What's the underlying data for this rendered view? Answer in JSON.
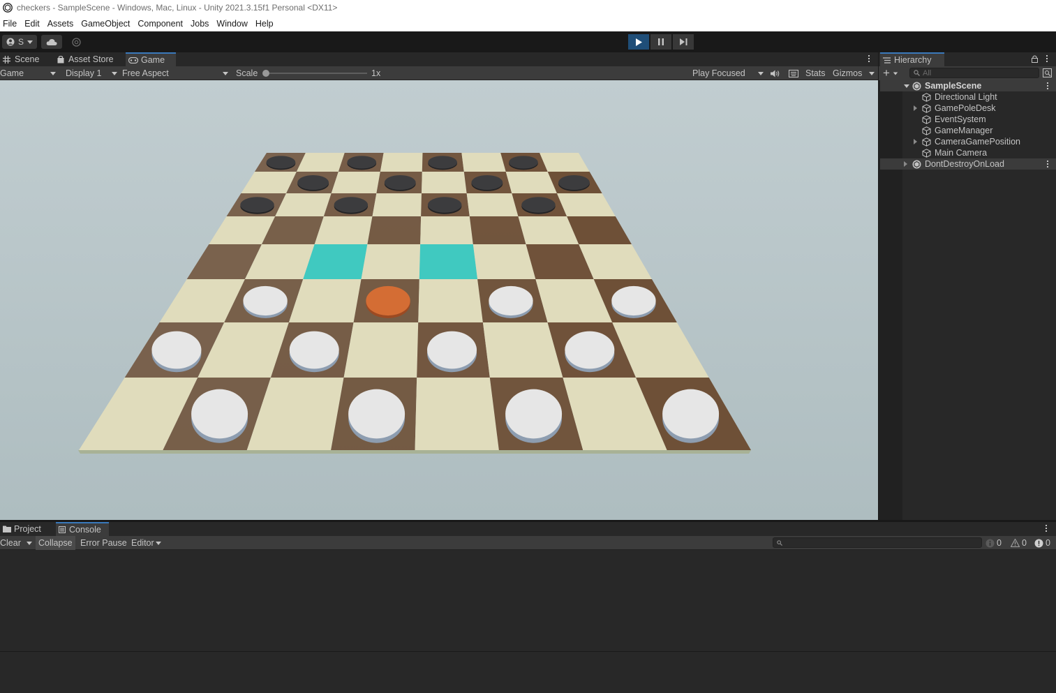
{
  "window": {
    "title": "checkers - SampleScene - Windows, Mac, Linux - Unity 2021.3.15f1 Personal <DX11>"
  },
  "menu": [
    "File",
    "Edit",
    "Assets",
    "GameObject",
    "Component",
    "Jobs",
    "Window",
    "Help"
  ],
  "toolbar": {
    "account_label": "S",
    "icons": [
      "account-icon",
      "cloud-icon",
      "collab-icon",
      "play-icon",
      "pause-icon",
      "step-icon"
    ]
  },
  "game_view": {
    "tabs": [
      "Scene",
      "Asset Store",
      "Game"
    ],
    "active_tab": "Game",
    "controls": {
      "mode": "Game",
      "display": "Display 1",
      "aspect": "Free Aspect",
      "scale_label": "Scale",
      "scale_value": "1x",
      "play_focused": "Play Focused",
      "stats": "Stats",
      "gizmos": "Gizmos"
    },
    "colors": {
      "sky": "#b2c1c4",
      "light_square": "#e0dcbc",
      "dark_square": "#6e5037",
      "highlight": "#40c9c0",
      "black_piece": "#3c3c3e",
      "white_piece": "#e6e6e6",
      "selected_piece": "#d46d34"
    },
    "board": {
      "rows": 8,
      "cols": 8,
      "highlighted_squares": [
        [
          4,
          2
        ],
        [
          4,
          4
        ]
      ],
      "black_pieces": [
        [
          0,
          0
        ],
        [
          0,
          2
        ],
        [
          0,
          4
        ],
        [
          0,
          6
        ],
        [
          1,
          1
        ],
        [
          1,
          3
        ],
        [
          1,
          5
        ],
        [
          1,
          7
        ],
        [
          2,
          0
        ],
        [
          2,
          2
        ],
        [
          2,
          4
        ],
        [
          2,
          6
        ]
      ],
      "white_pieces": [
        [
          5,
          1
        ],
        [
          5,
          5
        ],
        [
          5,
          7
        ],
        [
          6,
          0
        ],
        [
          6,
          2
        ],
        [
          6,
          4
        ],
        [
          6,
          6
        ],
        [
          7,
          1
        ],
        [
          7,
          3
        ],
        [
          7,
          5
        ],
        [
          7,
          7
        ]
      ],
      "selected_pieces": [
        [
          5,
          3
        ]
      ]
    }
  },
  "hierarchy": {
    "title": "Hierarchy",
    "search_placeholder": "All",
    "items": [
      {
        "label": "SampleScene",
        "type": "scene",
        "expanded": true
      },
      {
        "label": "Directional Light",
        "type": "object"
      },
      {
        "label": "GamePoleDesk",
        "type": "object",
        "has_children": true
      },
      {
        "label": "EventSystem",
        "type": "object"
      },
      {
        "label": "GameManager",
        "type": "object"
      },
      {
        "label": "CameraGamePosition",
        "type": "object",
        "has_children": true
      },
      {
        "label": "Main Camera",
        "type": "object"
      },
      {
        "label": "DontDestroyOnLoad",
        "type": "scene",
        "expanded": false
      }
    ]
  },
  "bottom_panel": {
    "tabs": [
      "Project",
      "Console"
    ],
    "active_tab": "Console",
    "buttons": {
      "clear": "Clear",
      "collapse": "Collapse",
      "error_pause": "Error Pause",
      "editor": "Editor"
    },
    "counts": {
      "info": "0",
      "warnings": "0",
      "errors": "0"
    }
  }
}
